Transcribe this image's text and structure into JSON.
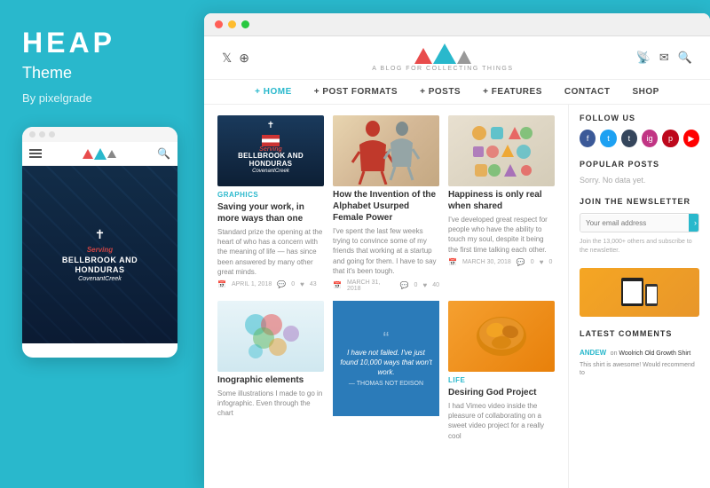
{
  "left": {
    "brand": "HEAP",
    "subtitle": "Theme",
    "author": "By pixelgrade",
    "mobile_dots": [
      "dot1",
      "dot2",
      "dot3"
    ],
    "mobile_hero": {
      "line1": "Serving",
      "line2": "BELLBROOK AND",
      "line3": "HONDURAS",
      "line4": "CovenantCreek"
    }
  },
  "browser": {
    "dots": [
      "red",
      "yellow",
      "green"
    ],
    "header": {
      "tagline": "A BLOG FOR COLLECTING THINGS",
      "social_left": [
        "twitter",
        "pinterest"
      ],
      "social_right": [
        "rss",
        "email",
        "search"
      ]
    },
    "nav": {
      "items": [
        "+ HOME",
        "+ POST FORMATS",
        "+ POSTS",
        "+ FEATURES",
        "CONTACT",
        "SHOP"
      ]
    },
    "posts": [
      {
        "category": "GRAPHICS",
        "title": "Saving your work, in more ways than one",
        "excerpt": "Standard prize the opening at the heart of who has a concern with the meaning of life — has since been answered by many other great minds.",
        "date": "APRIL 1, 2018",
        "comments": "0",
        "likes": "43"
      },
      {
        "category": "",
        "title": "How the Invention of the Alphabet Usurped Female Power",
        "excerpt": "I've spent the last few weeks trying to convince some of my friends that working at a startup and going for them. I have to say that it's been tough.",
        "date": "MARCH 31, 2018",
        "comments": "0",
        "likes": "40"
      },
      {
        "category": "",
        "title": "Happiness is only real when shared",
        "excerpt": "I've developed great respect for people who have the ability to touch my soul, despite it being the first time talking each other.",
        "date": "MARCH 30, 2018",
        "comments": "0",
        "likes": "0"
      }
    ],
    "posts_row2": [
      {
        "category": "",
        "title": "Inographic elements",
        "excerpt": "Some illustrations I made to go in infographic. Even through the chart",
        "date": "",
        "comments": "",
        "likes": ""
      },
      {
        "quote": {
          "mark": "“",
          "text": "I have not failed. I've just found 10,000 ways that won't work.",
          "author": "— THOMAS NOT EDISON"
        }
      },
      {
        "category": "LIFE",
        "title": "Desiring God Project",
        "excerpt": "I had Vimeo video inside the pleasure of collaborating on a sweet video project for a really cool",
        "date": "",
        "comments": "",
        "likes": ""
      }
    ],
    "sidebar": {
      "follow_us_label": "FOLLOW US",
      "social_icons": [
        "facebook",
        "twitter",
        "tumblr",
        "instagram",
        "pinterest",
        "youtube"
      ],
      "popular_posts_label": "POPULAR POSTS",
      "popular_posts_empty": "Sorry. No data yet.",
      "newsletter_label": "JOIN THE NEWSLETTER",
      "newsletter_placeholder": "Your email address",
      "newsletter_btn": "›",
      "newsletter_desc": "Join the 13,000+ others and subscribe to the newsletter.",
      "latest_comments_label": "LATEST COMMENTS",
      "comments": [
        {
          "author": "ANDEW",
          "on_text": "Woolrich Old Growth Shirt",
          "text": "This shirt is awesome! Would recommend to"
        }
      ]
    }
  }
}
